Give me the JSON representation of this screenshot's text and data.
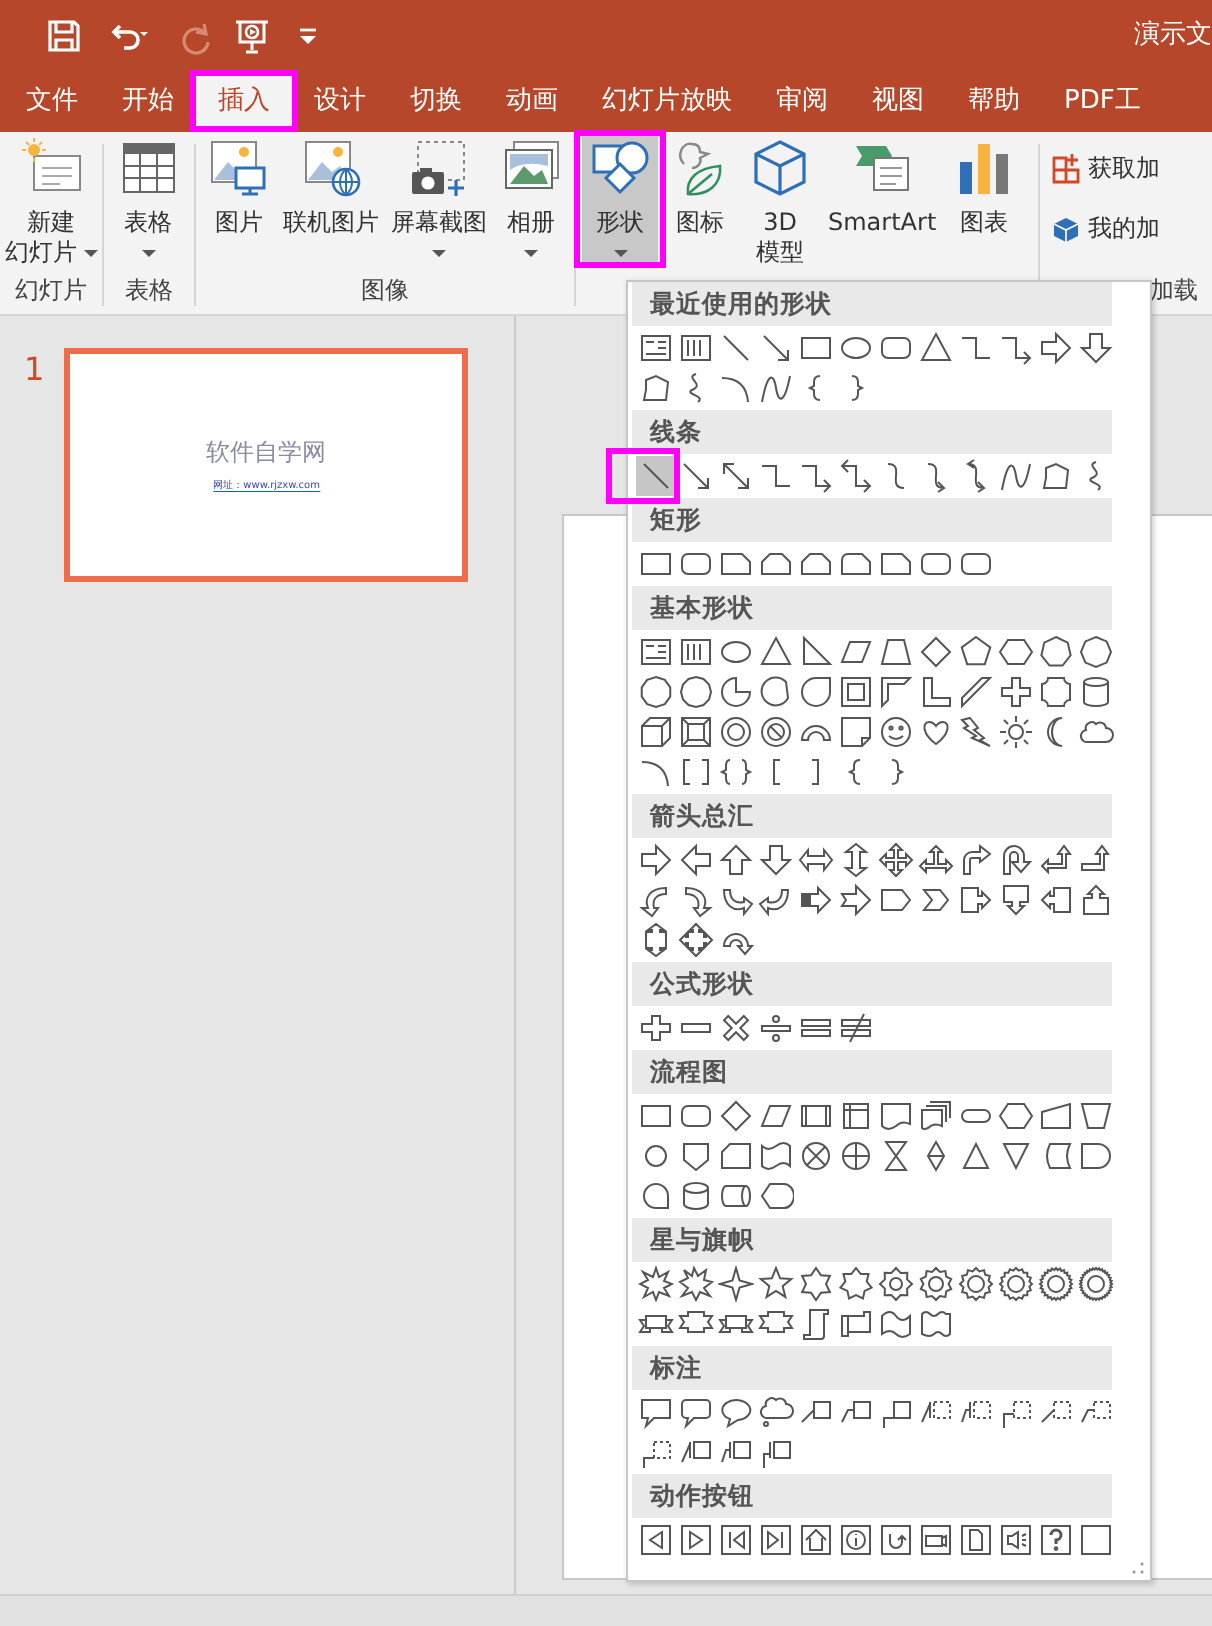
{
  "title_bar": {
    "quick_access": [
      {
        "disabled": false
      },
      {
        "disabled": false
      },
      {
        "disabled": true
      },
      {
        "disabled": false
      },
      {
        "disabled": false
      }
    ],
    "title": "演示文"
  },
  "tabs": [
    {
      "label": "文件",
      "selected": false,
      "annotated": false
    },
    {
      "label": "开始",
      "selected": false,
      "annotated": false
    },
    {
      "label": "插入",
      "selected": true,
      "annotated": true
    },
    {
      "label": "设计",
      "selected": false,
      "annotated": false
    },
    {
      "label": "切换",
      "selected": false,
      "annotated": false
    },
    {
      "label": "动画",
      "selected": false,
      "annotated": false
    },
    {
      "label": "幻灯片放映",
      "selected": false,
      "annotated": false
    },
    {
      "label": "审阅",
      "selected": false,
      "annotated": false
    },
    {
      "label": "视图",
      "selected": false,
      "annotated": false
    },
    {
      "label": "帮助",
      "selected": false,
      "annotated": false
    },
    {
      "label": "PDF工",
      "selected": false,
      "annotated": false
    }
  ],
  "ribbon": {
    "groups": [
      {
        "label": "幻灯片",
        "buttons": [
          {
            "kind": "large",
            "lines": [
              "新建",
              "幻灯片"
            ],
            "dropdown": true,
            "pressed": false,
            "annotated": false
          }
        ]
      },
      {
        "label": "表格",
        "buttons": [
          {
            "kind": "large",
            "lines": [
              "表格"
            ],
            "dropdown": true,
            "pressed": false,
            "annotated": false
          }
        ]
      },
      {
        "label": "图像",
        "buttons": [
          {
            "kind": "large",
            "lines": [
              "图片"
            ],
            "dropdown": false,
            "pressed": false,
            "annotated": false
          },
          {
            "kind": "large",
            "lines": [
              "联机图片"
            ],
            "dropdown": false,
            "pressed": false,
            "annotated": false
          },
          {
            "kind": "large",
            "lines": [
              "屏幕截图"
            ],
            "dropdown": true,
            "pressed": false,
            "annotated": false
          },
          {
            "kind": "large",
            "lines": [
              "相册"
            ],
            "dropdown": true,
            "pressed": false,
            "annotated": false
          }
        ]
      },
      {
        "buttons": [
          {
            "kind": "large",
            "lines": [
              "形状"
            ],
            "dropdown": true,
            "pressed": true,
            "annotated": true
          },
          {
            "kind": "large",
            "lines": [
              "图标"
            ],
            "dropdown": false,
            "pressed": false,
            "annotated": false
          },
          {
            "kind": "large",
            "lines": [
              "3D",
              "模型"
            ],
            "dropdown": false,
            "pressed": false,
            "annotated": false
          },
          {
            "kind": "large",
            "lines": [
              "SmartArt"
            ],
            "dropdown": false,
            "pressed": false,
            "annotated": false
          },
          {
            "kind": "large",
            "lines": [
              "图表"
            ],
            "dropdown": false,
            "pressed": false,
            "annotated": false
          }
        ]
      },
      {
        "label": "加载",
        "buttons": [
          {
            "kind": "small",
            "lines": [
              "获取加"
            ],
            "dropdown": false,
            "pressed": false,
            "annotated": false
          },
          {
            "kind": "small",
            "lines": [
              "我的加"
            ],
            "dropdown": false,
            "pressed": false,
            "annotated": false
          }
        ]
      }
    ]
  },
  "slides": [
    {
      "number": "1",
      "selected": true,
      "title": "软件自学网",
      "subtitle": "网址：www.rjzxw.com"
    }
  ],
  "shapes_menu": {
    "sections": [
      {
        "title": "最近使用的形状"
      },
      {
        "title": "线条",
        "items": [
          {
            "hovered": true,
            "annotated": true
          },
          {
            "hovered": false,
            "annotated": false
          },
          {
            "hovered": false,
            "annotated": false
          },
          {
            "hovered": false,
            "annotated": false
          },
          {
            "hovered": false,
            "annotated": false
          },
          {
            "hovered": false,
            "annotated": false
          },
          {
            "hovered": false,
            "annotated": false
          },
          {
            "hovered": false,
            "annotated": false
          },
          {
            "hovered": false,
            "annotated": false
          },
          {
            "hovered": false,
            "annotated": false
          },
          {
            "hovered": false,
            "annotated": false
          },
          {
            "hovered": false,
            "annotated": false
          }
        ]
      },
      {
        "title": "矩形"
      },
      {
        "title": "基本形状"
      },
      {
        "title": "箭头总汇"
      },
      {
        "title": "公式形状"
      },
      {
        "title": "流程图"
      },
      {
        "title": "星与旗帜"
      },
      {
        "title": "标注"
      },
      {
        "title": "动作按钮"
      }
    ]
  }
}
